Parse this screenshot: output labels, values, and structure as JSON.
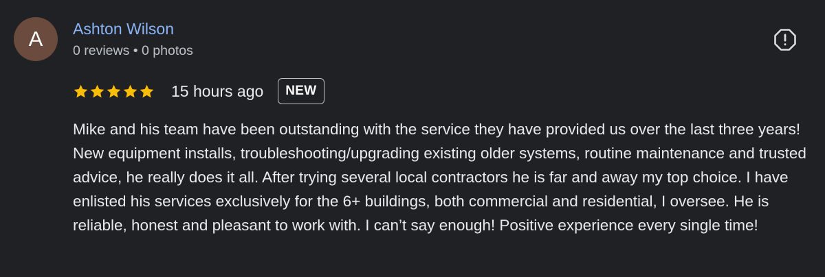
{
  "review": {
    "author": {
      "initial": "A",
      "name": "Ashton Wilson",
      "meta": "0 reviews • 0 photos",
      "avatar_color": "#6b4b3e"
    },
    "rating": {
      "stars": 5,
      "max_stars": 5,
      "star_color": "#fbbc04"
    },
    "time_ago": "15 hours ago",
    "badge": "NEW",
    "text": "Mike and his team have been outstanding with the service they have provided us over the last three years! New equipment installs, troubleshooting/upgrading existing older systems, routine maintenance and trusted advice, he really does it all. After trying several local contractors he is far and away my top choice. I have enlisted his services exclusively for the 6+ buildings, both commercial and residential, I oversee. He is reliable, honest and pleasant to work with. I can’t say enough! Positive experience every single time!",
    "report_icon": "report-icon"
  },
  "colors": {
    "background": "#202124",
    "link": "#8ab4f8",
    "secondary_text": "#bdc1c6",
    "primary_text": "#e8eaed"
  }
}
